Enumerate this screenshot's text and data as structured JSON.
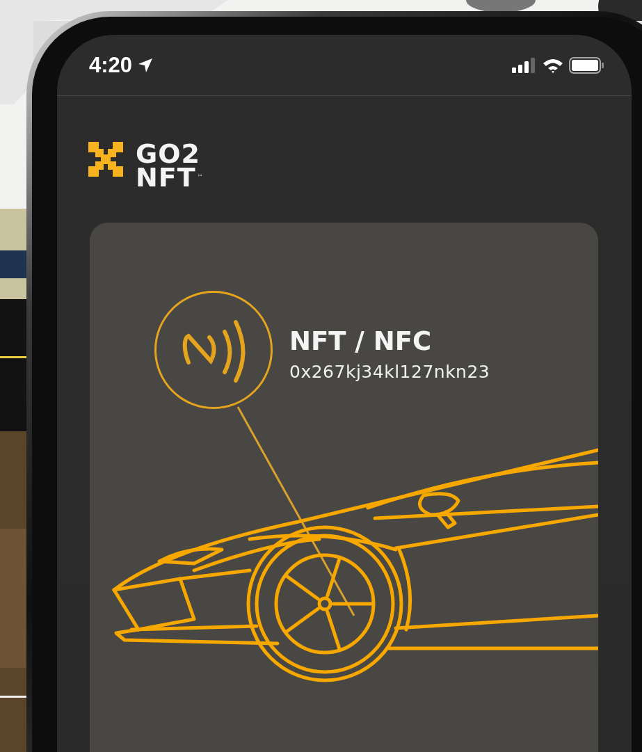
{
  "status_bar": {
    "time": "4:20"
  },
  "logo": {
    "line_1": "GO2",
    "line_2": "NFT",
    "trademark": "™"
  },
  "card": {
    "title": "NFT / NFC",
    "token_id": "0x267kj34kl127nkn23"
  }
}
